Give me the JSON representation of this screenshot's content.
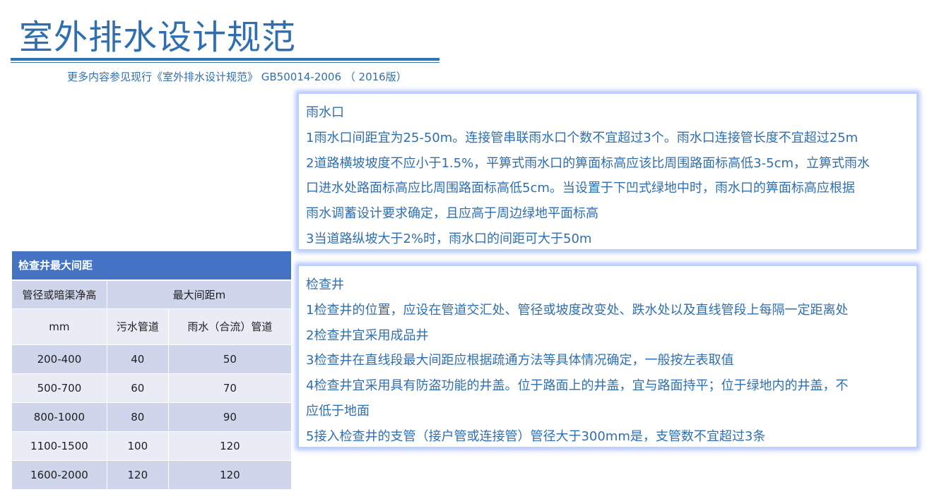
{
  "header": {
    "title": "室外排水设计规范",
    "subtitle": "更多内容参见现行《室外排水设计规范》 GB50014-2006 （ 2016版）"
  },
  "rain_inlet": {
    "heading": "雨水口",
    "lines": [
      "1雨水口间距宜为25-50m。连接管串联雨水口个数不宜超过3个。雨水口连接管长度不宜超过25m",
      "2道路横坡坡度不应小于1.5%，平箅式雨水口的箅面标高应该比周围路面标高低3-5cm，立箅式雨水",
      "口进水处路面标高应比周围路面标高低5cm。当设置于下凹式绿地中时，雨水口的箅面标高应根据",
      "雨水调蓄设计要求确定，且应高于周边绿地平面标高",
      "3当道路纵坡大于2%时，雨水口的间距可大于50m"
    ]
  },
  "inspection_well": {
    "heading": "检查井",
    "lines": [
      "1检查井的位置，应设在管道交汇处、管径或坡度改变处、跌水处以及直线管段上每隔一定距离处",
      "2检查井宜采用成品井",
      "3检查井在直线段最大间距应根据疏通方法等具体情况确定，一般按左表取值",
      "4检查井宜采用具有防盗功能的井盖。位于路面上的井盖，宜与路面持平；位于绿地内的井盖，不",
      "应低于地面",
      "5接入检查井的支管（接户管或连接管）管径大于300mm是，支管数不宜超过3条"
    ]
  },
  "table": {
    "title": "检查井最大间距",
    "col1_header": "管径或暗渠净高",
    "col1_unit": "mm",
    "group_header": "最大间距m",
    "sub_header_1": "污水管道",
    "sub_header_2": "雨水（合流）管道",
    "rows": [
      {
        "size": "200-400",
        "sewage": "40",
        "storm": "50"
      },
      {
        "size": "500-700",
        "sewage": "60",
        "storm": "70"
      },
      {
        "size": "800-1000",
        "sewage": "80",
        "storm": "90"
      },
      {
        "size": "1100-1500",
        "sewage": "100",
        "storm": "120"
      },
      {
        "size": "1600-2000",
        "sewage": "120",
        "storm": "120"
      }
    ]
  }
}
